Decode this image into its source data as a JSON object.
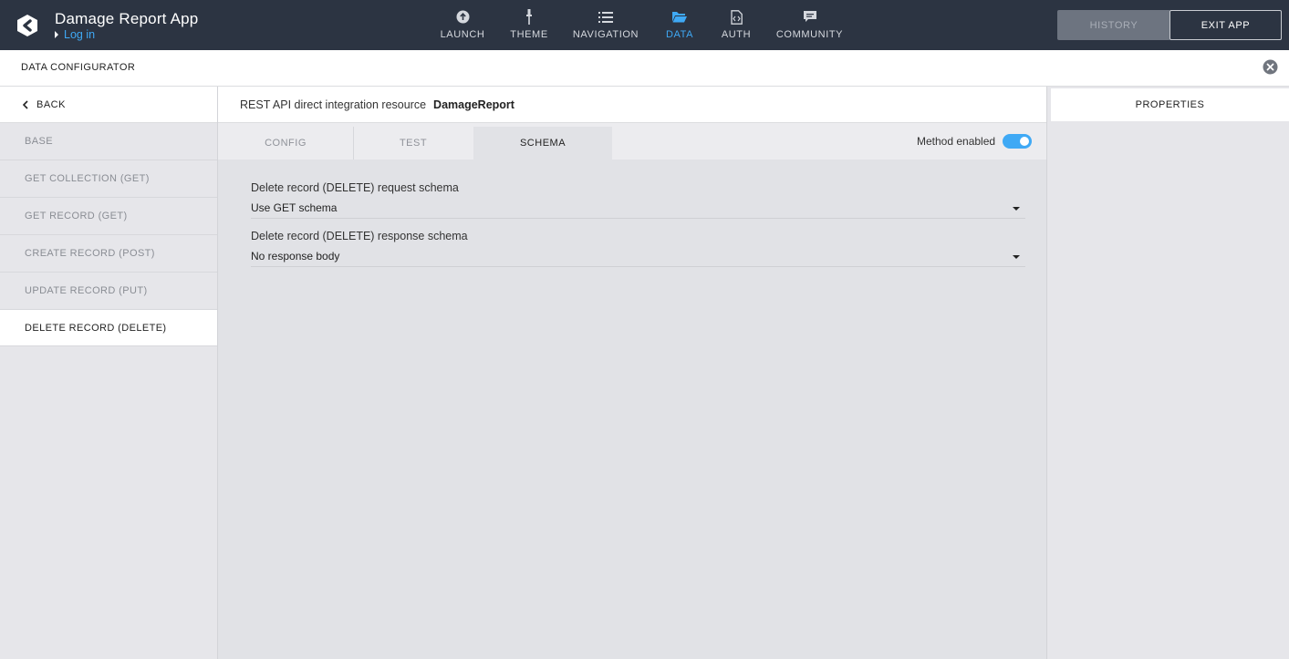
{
  "header": {
    "app_title": "Damage Report App",
    "login_label": "Log in",
    "nav": [
      {
        "label": "LAUNCH",
        "icon": "upload-circle-icon"
      },
      {
        "label": "THEME",
        "icon": "brush-icon"
      },
      {
        "label": "NAVIGATION",
        "icon": "list-icon"
      },
      {
        "label": "DATA",
        "icon": "folder-open-icon",
        "active": true
      },
      {
        "label": "AUTH",
        "icon": "code-file-icon"
      },
      {
        "label": "COMMUNITY",
        "icon": "chat-icon"
      }
    ],
    "history_label": "HISTORY",
    "exit_label": "EXIT APP",
    "accent_color": "#3fa9f5"
  },
  "configurator": {
    "title": "DATA CONFIGURATOR"
  },
  "sidebar": {
    "back_label": "BACK",
    "items": [
      {
        "label": "BASE"
      },
      {
        "label": "GET COLLECTION (GET)"
      },
      {
        "label": "GET RECORD (GET)"
      },
      {
        "label": "CREATE RECORD (POST)"
      },
      {
        "label": "UPDATE RECORD (PUT)"
      },
      {
        "label": "DELETE RECORD (DELETE)",
        "active": true
      }
    ]
  },
  "main": {
    "resource_label": "REST API direct integration resource",
    "resource_name": "DamageReport",
    "tabs": [
      {
        "label": "CONFIG"
      },
      {
        "label": "TEST"
      },
      {
        "label": "SCHEMA",
        "active": true
      }
    ],
    "method_enabled_label": "Method enabled",
    "method_enabled": true,
    "fields": [
      {
        "label": "Delete record (DELETE) request schema",
        "value": "Use GET schema"
      },
      {
        "label": "Delete record (DELETE) response schema",
        "value": "No response body"
      }
    ]
  },
  "properties": {
    "title": "PROPERTIES"
  }
}
